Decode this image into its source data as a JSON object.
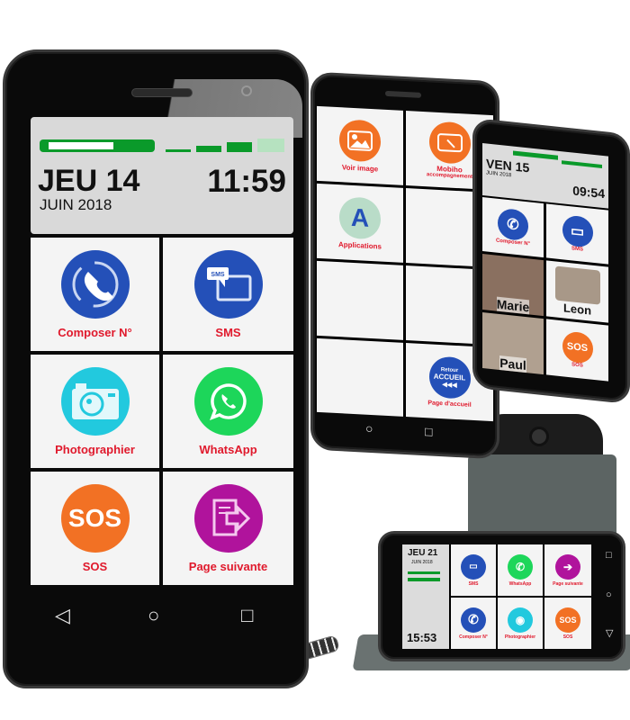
{
  "main_phone": {
    "day": "JEU 14",
    "month": "JUIN 2018",
    "time": "11:59",
    "battery_level": 0.65,
    "signal_bars": 3,
    "tiles": [
      {
        "label": "Composer N°",
        "icon": "phone-icon",
        "color": "#2450b8"
      },
      {
        "label": "SMS",
        "icon": "sms-icon",
        "color": "#2450b8",
        "icon_text": "SMS"
      },
      {
        "label": "Photographier",
        "icon": "camera-icon",
        "color": "#22c9de"
      },
      {
        "label": "WhatsApp",
        "icon": "whatsapp-icon",
        "color": "#1dd65a"
      },
      {
        "label": "SOS",
        "icon": "sos-icon",
        "color": "#f27124",
        "icon_text": "SOS"
      },
      {
        "label": "Page suivante",
        "icon": "next-page-icon",
        "color": "#b0139c"
      }
    ],
    "nav": {
      "back": "◁",
      "home": "○",
      "recents": "□"
    }
  },
  "second_phone": {
    "tiles": [
      {
        "label": "Voir image",
        "icon": "image-icon",
        "color": "#f27124"
      },
      {
        "label": "Mobiho",
        "sublabel": "accompagnement",
        "icon": "tablet-touch-icon",
        "color": "#f27124"
      },
      {
        "label": "Applications",
        "icon": "applications-icon",
        "color": "#b9dcc8",
        "icon_text": "A"
      },
      {
        "label": ""
      },
      {
        "label": ""
      },
      {
        "label": ""
      },
      {
        "label": ""
      },
      {
        "label": "Page d'accueil",
        "icon": "home-return-icon",
        "color": "#2450b8",
        "icon_text_top": "Retour",
        "icon_text": "ACCUEIL",
        "icon_text_bottom": "◀◀◀"
      }
    ],
    "nav": {
      "home": "○",
      "recents": "□"
    }
  },
  "third_phone": {
    "day": "VEN 15",
    "month": "JUIN 2018",
    "time": "09:54",
    "tiles": [
      {
        "label": "Composer N°",
        "icon": "phone-icon",
        "color": "#2450b8"
      },
      {
        "label": "SMS",
        "icon": "sms-icon",
        "color": "#2450b8"
      },
      {
        "label": "Marie",
        "icon": "contact-photo-icon"
      },
      {
        "label": "Leon",
        "icon": "contact-photo-icon"
      },
      {
        "label": "Paul",
        "icon": "contact-photo-icon"
      },
      {
        "label": "SOS",
        "icon": "sos-icon",
        "color": "#f27124",
        "icon_text": "SOS"
      }
    ]
  },
  "landscape_phone": {
    "day": "JEU 21",
    "month": "JUIN 2018",
    "time": "15:53",
    "tiles": [
      {
        "label": "SMS",
        "icon": "sms-icon",
        "color": "#2450b8"
      },
      {
        "label": "WhatsApp",
        "icon": "whatsapp-icon",
        "color": "#1dd65a"
      },
      {
        "label": "Page suivante",
        "icon": "next-page-icon",
        "color": "#b0139c"
      },
      {
        "label": "Composer N°",
        "icon": "phone-icon",
        "color": "#2450b8"
      },
      {
        "label": "Photographier",
        "icon": "camera-icon",
        "color": "#22c9de"
      },
      {
        "label": "SOS",
        "icon": "sos-icon",
        "color": "#f27124",
        "icon_text": "SOS"
      }
    ]
  }
}
